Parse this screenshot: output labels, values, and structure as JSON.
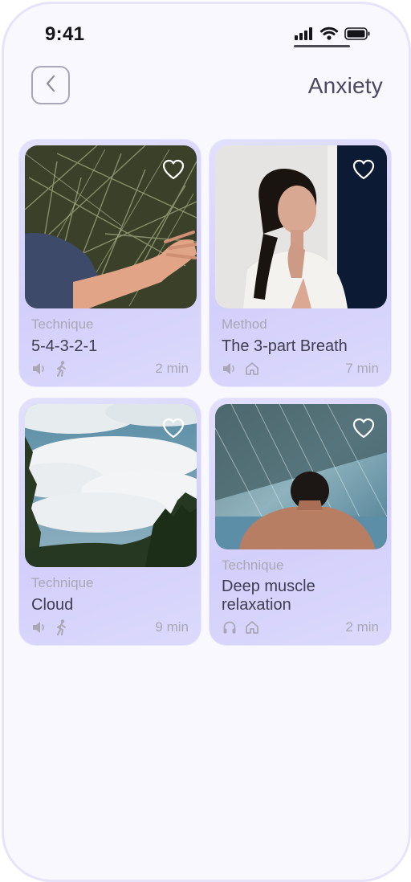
{
  "status_bar": {
    "time": "9:41"
  },
  "header": {
    "title": "Anxiety"
  },
  "cards": [
    {
      "category": "Technique",
      "title": "5-4-3-2-1",
      "duration": "2 min",
      "icons": [
        "speaker-icon",
        "walking-icon"
      ],
      "image": "hand touching grass"
    },
    {
      "category": "Method",
      "title": "The 3-part Breath",
      "duration": "7 min",
      "icons": [
        "speaker-icon",
        "home-icon"
      ],
      "image": "woman with eyes closed touching neck"
    },
    {
      "category": "Technique",
      "title": "Cloud",
      "duration": "9 min",
      "icons": [
        "speaker-icon",
        "walking-icon"
      ],
      "image": "clouds above trees"
    },
    {
      "category": "Technique",
      "title_lines": [
        "Deep muscle",
        "relaxation"
      ],
      "duration": "2 min",
      "icons": [
        "headphones-icon",
        "home-icon"
      ],
      "image": "man in rain"
    }
  ]
}
